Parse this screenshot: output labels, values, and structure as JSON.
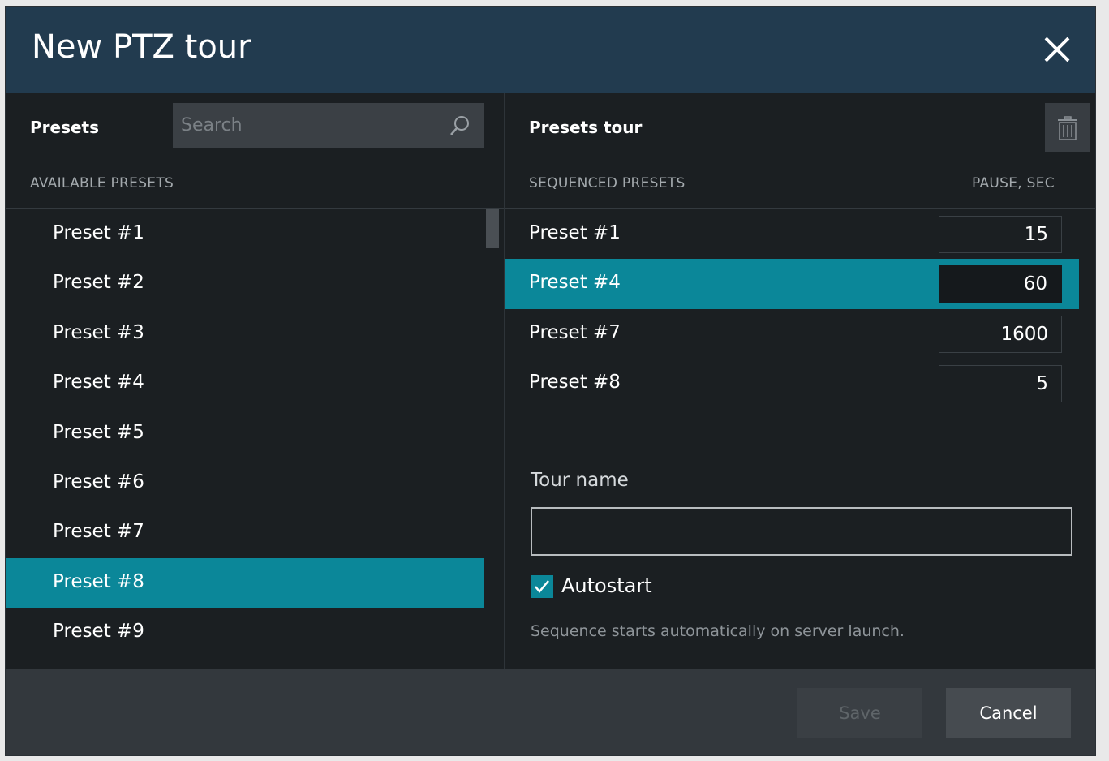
{
  "dialog": {
    "title": "New PTZ tour"
  },
  "left_panel": {
    "header_label": "Presets",
    "search_placeholder": "Search",
    "column_header": "AVAILABLE PRESETS",
    "items": [
      {
        "label": "Preset #1",
        "selected": false
      },
      {
        "label": "Preset #2",
        "selected": false
      },
      {
        "label": "Preset #3",
        "selected": false
      },
      {
        "label": "Preset #4",
        "selected": false
      },
      {
        "label": "Preset #5",
        "selected": false
      },
      {
        "label": "Preset #6",
        "selected": false
      },
      {
        "label": "Preset #7",
        "selected": false
      },
      {
        "label": "Preset #8",
        "selected": true
      },
      {
        "label": "Preset #9",
        "selected": false
      }
    ]
  },
  "right_panel": {
    "header_label": "Presets tour",
    "column_header_left": "SEQUENCED PRESETS",
    "column_header_right": "PAUSE, SEC",
    "rows": [
      {
        "label": "Preset #1",
        "pause": "15",
        "selected": false
      },
      {
        "label": "Preset #4",
        "pause": "60",
        "selected": true
      },
      {
        "label": "Preset #7",
        "pause": "1600",
        "selected": false
      },
      {
        "label": "Preset #8",
        "pause": "5",
        "selected": false
      }
    ],
    "tour_name_label": "Tour name",
    "tour_name_value": "",
    "autostart_label": "Autostart",
    "autostart_checked": true,
    "autostart_hint": "Sequence starts automatically on server launch."
  },
  "footer": {
    "save_label": "Save",
    "cancel_label": "Cancel"
  },
  "colors": {
    "title_bar": "#223b4f",
    "accent": "#0b8799",
    "panel_bg": "#1b1f22",
    "footer_bg": "#33383d"
  },
  "icons": {
    "close": "close-icon",
    "search": "search-icon",
    "trash": "trash-icon",
    "check": "check-icon"
  }
}
